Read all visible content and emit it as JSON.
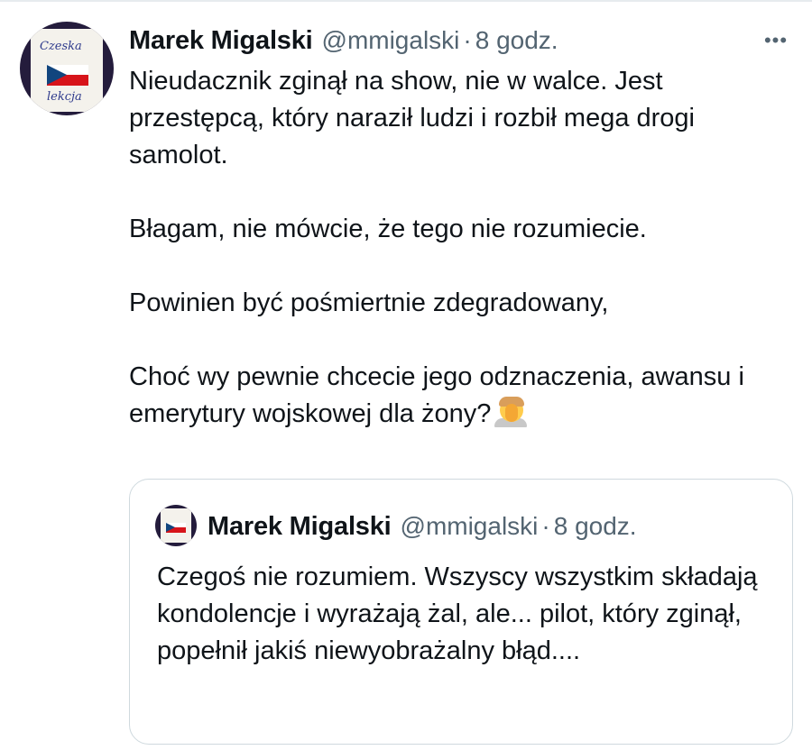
{
  "tweet": {
    "author_name": "Marek Migalski",
    "handle": "@mmigalski",
    "separator": "·",
    "time": "8 godz.",
    "more_icon": "more-dots-icon",
    "more_glyph": "•••",
    "avatar_text_top": "Czeska",
    "avatar_text_bottom": "lekcja",
    "paragraphs": [
      "Nieudacznik zginął na show, nie w walce. Jest przestępcą, który naraził ludzi i rozbił mega drogi samolot.",
      "Błagam, nie mówcie, że tego nie rozumiecie.",
      "Powinien być pośmiertnie zdegradowany,",
      "Choć wy pewnie chcecie jego odznaczenia, awansu i emerytury wojskowej dla żony?"
    ],
    "emoji_icon": "face-palm-emoji-icon"
  },
  "quoted_tweet": {
    "author_name": "Marek Migalski",
    "handle": "@mmigalski",
    "separator": "·",
    "time": "8 godz.",
    "text": "Czegoś nie rozumiem. Wszyscy wszystkim składają kondolencje i wyrażają żal, ale... pilot, który zginął, popełnił jakiś niewyobrażalny błąd...."
  },
  "colors": {
    "text_primary": "#0f1419",
    "text_secondary": "#536471",
    "border": "#cfd9de",
    "background": "#ffffff"
  }
}
